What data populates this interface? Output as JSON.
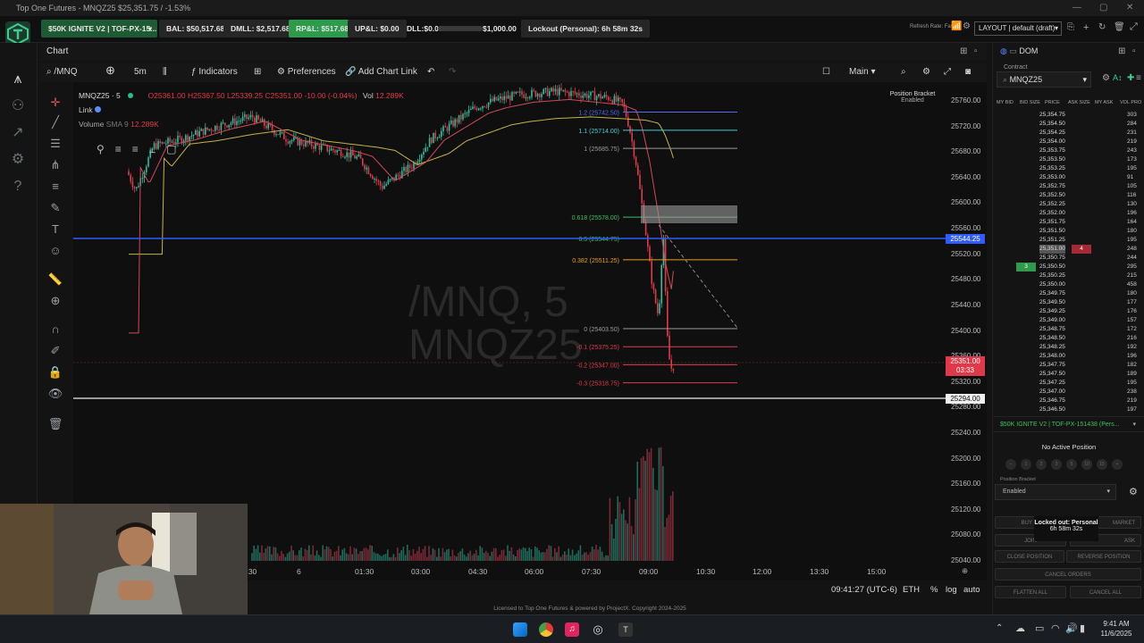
{
  "window": {
    "title": "Top One Futures - MNQZ25 $25,351.75 / -1.53%"
  },
  "topbar": {
    "account": "$50K IGNITE V2 | TOF-PX-15...",
    "bal": "BAL: $50,517.68",
    "dmll": "DMLL: $2,517.68",
    "rpl": "RP&L: $517.68",
    "upl": "UP&L: $0.00",
    "dll": "DLL:$0.00",
    "dll_limit": "$1,000.00",
    "dll_progress": 0.0,
    "lockout": "Lockout (Personal): 6h 58m 32s",
    "refresh": "Refresh Rate: Fast",
    "layout": "LAYOUT | default (draft)"
  },
  "chart_header": {
    "title": "Chart"
  },
  "toolbar": {
    "symbol": "/MNQ",
    "interval": "5m",
    "indicators": "Indicators",
    "preferences": "Preferences",
    "add_link": "Add Chart Link",
    "main": "Main"
  },
  "legend": {
    "symbol": "MNQZ25 · 5",
    "o": "O25361.00",
    "h": "H25367.50",
    "l": "L25339.25",
    "c": "C25351.00",
    "chg": "-10.00 (-0.04%)",
    "vol_label": "Vol",
    "vol": "12.289K",
    "link": "Link",
    "volume_label": "Volume",
    "sma": "SMA 9",
    "sma_val": "12.289K"
  },
  "position_bracket": {
    "label": "Position Bracket",
    "state": "Enabled"
  },
  "watermark": {
    "line1": "/MNQ, 5",
    "line2": "MNQZ25"
  },
  "fib_levels": [
    {
      "label": "1.2 (25742.50)",
      "color": "#4f6bff"
    },
    {
      "label": "1.1 (25714.00)",
      "color": "#3fd0d0"
    },
    {
      "label": "1 (25685.75)",
      "color": "#9a9a9a"
    },
    {
      "label": "0.618 (25578.00)",
      "color": "#3fbf60"
    },
    {
      "label": "0.5 (25544.75)",
      "color": "#3fbf60"
    },
    {
      "label": "0.382 (25511.25)",
      "color": "#e5a020"
    },
    {
      "label": "0 (25403.50)",
      "color": "#9a9a9a"
    },
    {
      "label": "-0.1 (25375.25)",
      "color": "#e03a4a"
    },
    {
      "label": "-0.2 (25347.00)",
      "color": "#e03a4a"
    },
    {
      "label": "-0.3 (25318.75)",
      "color": "#e03a4a"
    }
  ],
  "price_axis": {
    "ticks": [
      "25760.00",
      "25720.00",
      "25680.00",
      "25640.00",
      "25600.00",
      "25560.00",
      "25520.00",
      "25480.00",
      "25440.00",
      "25400.00",
      "25360.00",
      "25320.00",
      "25280.00",
      "25240.00",
      "25200.00",
      "25160.00",
      "25120.00",
      "25080.00",
      "25040.00"
    ],
    "blue_line": "25544.25",
    "current": "25351.00",
    "countdown": "03:33",
    "white_line": "25294.00"
  },
  "time_axis": {
    "ticks": [
      "22:30",
      "6",
      "01:30",
      "03:00",
      "04:30",
      "06:00",
      "07:30",
      "09:00",
      "10:30",
      "12:00",
      "13:30",
      "15:00"
    ]
  },
  "status": {
    "clock": "09:41:27 (UTC-6)",
    "session": "ETH",
    "pct": "%",
    "log": "log",
    "auto": "auto"
  },
  "license": "Licensed to Top One Futures & powered by ProjectX. Copyright 2024-2025",
  "dom": {
    "tab": "DOM",
    "contract_label": "Contract",
    "contract": "MNQZ25",
    "headers": [
      "MY BID",
      "BID SIZE",
      "PRICE",
      "ASK SIZE",
      "MY ASK",
      "VOL PRO"
    ],
    "rows": [
      {
        "price": "25,355.00",
        "vol": "303"
      },
      {
        "price": "25,354.75",
        "vol": "303"
      },
      {
        "price": "25,354.50",
        "vol": "284"
      },
      {
        "price": "25,354.25",
        "vol": "231"
      },
      {
        "price": "25,354.00",
        "vol": "219"
      },
      {
        "price": "25,353.75",
        "vol": "243"
      },
      {
        "price": "25,353.50",
        "vol": "173"
      },
      {
        "price": "25,353.25",
        "vol": "195"
      },
      {
        "price": "25,353.00",
        "vol": "91"
      },
      {
        "price": "25,352.75",
        "vol": "105"
      },
      {
        "price": "25,352.50",
        "vol": "116"
      },
      {
        "price": "25,352.25",
        "vol": "130"
      },
      {
        "price": "25,352.00",
        "vol": "196"
      },
      {
        "price": "25,351.75",
        "vol": "164"
      },
      {
        "price": "25,351.50",
        "vol": "180"
      },
      {
        "price": "25,351.25",
        "vol": "195"
      },
      {
        "price": "25,351.00",
        "vol": "248",
        "ask": "4"
      },
      {
        "price": "25,350.75",
        "vol": "244"
      },
      {
        "price": "25,350.50",
        "vol": "295",
        "bid": "3"
      },
      {
        "price": "25,350.25",
        "vol": "215"
      },
      {
        "price": "25,350.00",
        "vol": "458"
      },
      {
        "price": "25,349.75",
        "vol": "180"
      },
      {
        "price": "25,349.50",
        "vol": "177"
      },
      {
        "price": "25,349.25",
        "vol": "176"
      },
      {
        "price": "25,349.00",
        "vol": "157"
      },
      {
        "price": "25,348.75",
        "vol": "172"
      },
      {
        "price": "25,348.50",
        "vol": "216"
      },
      {
        "price": "25,348.25",
        "vol": "192"
      },
      {
        "price": "25,348.00",
        "vol": "196"
      },
      {
        "price": "25,347.75",
        "vol": "182"
      },
      {
        "price": "25,347.50",
        "vol": "189"
      },
      {
        "price": "25,347.25",
        "vol": "195"
      },
      {
        "price": "25,347.00",
        "vol": "238"
      },
      {
        "price": "25,346.75",
        "vol": "219"
      },
      {
        "price": "25,346.50",
        "vol": "197"
      }
    ],
    "account": "$50K IGNITE V2 | TOF-PX-151438 (Pers...",
    "no_position": "No Active Position",
    "qty": [
      "1",
      "2",
      "3",
      "5",
      "10",
      "15"
    ],
    "bracket_label": "Position Bracket",
    "bracket_value": "Enabled",
    "tooltip_title": "Locked out: Personal",
    "tooltip_time": "6h 58m 32s",
    "buy": "BUY +1",
    "market": "MARKET",
    "join": "JOIN",
    "ask": "ASK",
    "close_position": "CLOSE POSITION",
    "reverse_position": "REVERSE POSITION",
    "cancel_orders": "CANCEL ORDERS",
    "flatten_all": "FLATTEN ALL",
    "cancel_all": "CANCEL ALL"
  },
  "tray": {
    "time": "9:41 AM",
    "date": "11/6/2025"
  }
}
